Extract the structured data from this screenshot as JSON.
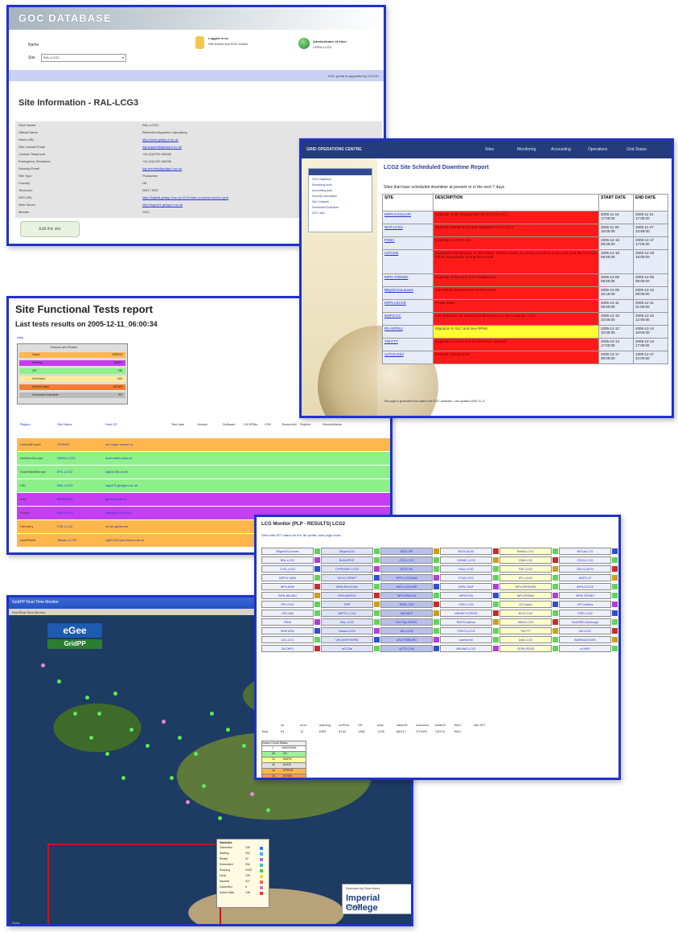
{
  "colors": {
    "border": "#1f33c9",
    "downtime_red": "#ff1a1a",
    "downtime_yellow": "#ffff33",
    "test_orange": "#ffb74d",
    "test_green": "#8ef08a",
    "test_purple": "#c33ff0"
  },
  "site_info": {
    "header_logo": "GOC DATABASE",
    "form_name_label": "Name",
    "form_name_value": "",
    "form_site_label": "Site",
    "form_site_value": "RAL-LCG2",
    "login_title": "Logged in as",
    "login_text": "Site Admin and ROC Admin",
    "role_title": "Administrator of sites:",
    "role_text": "CERN-LCG2",
    "band_text": "GOC portal is supported by CCLRC",
    "page_title": "Site Information - RAL-LCG3",
    "rows": [
      {
        "k": "Short Name",
        "v": "RAL-LCG3"
      },
      {
        "k": "Official Name",
        "v": "Rutherford Appleton Laboratory"
      },
      {
        "k": "Home URL",
        "v": "http://www.gridpp.rl.ac.uk"
      },
      {
        "k": "Site Contact Email",
        "v": "lcg-support@gridpp.rl.ac.uk"
      },
      {
        "k": "Contact Telephone",
        "v": "+44 (0)1235 445000"
      },
      {
        "k": "Emergency Telephone",
        "v": "+44 (0)1235 446000"
      },
      {
        "k": "Security Email",
        "v": "lcg-security@gridpp.rl.ac.uk"
      },
      {
        "k": "Site Type",
        "v": "Production"
      },
      {
        "k": "Country",
        "v": "UK"
      },
      {
        "k": "Timezone",
        "v": "GMT / BST"
      },
      {
        "k": "GIIS URL",
        "v": "ldap://lcgbdii.gridpp.rl.ac.uk:2170/mds-vo-name=local,o=grid"
      },
      {
        "k": "Web Server",
        "v": "http://lcgce01.gridpp.rl.ac.uk"
      },
      {
        "k": "Monitor",
        "v": "GOC"
      }
    ],
    "button": "Edit this site"
  },
  "downtime": {
    "nav": [
      "GRID OPERATIONS CENTRE",
      "Sites",
      "Monitoring",
      "Accounting",
      "Operations",
      "Grid Status"
    ],
    "menu": [
      "GOC Database",
      "Monitoring tools",
      "Accounting data",
      "Security Information",
      "Site Contacts",
      "Scheduled Downtime",
      "GOC Wiki"
    ],
    "title": "LCG2 Site Scheduled Downtime Report",
    "subtitle": "Sites that have scheduled downtime at present or in the next 7 days",
    "headers": [
      "SITE",
      "DESCRIPTION",
      "START DATE",
      "END DATE"
    ],
    "rows": [
      {
        "site": "INFN-CAGLIARI",
        "desc": "Upgrade of the storage and CE to LCG 2.6.0",
        "start": "2005-11-16 17:00:00",
        "end": "2005-11-21 17:00:00",
        "color": "red"
      },
      {
        "site": "NCP-LCG2",
        "desc": "Network maintenance and upgrade to LCG-2.6.0",
        "start": "2005-11-25 18:00:00",
        "end": "2005-11-27 23:59:00",
        "color": "red"
      },
      {
        "site": "PSNC",
        "desc": "Upgrade to LCG 2.6.0",
        "start": "2005-12-15 09:00:00",
        "end": "2005-12-17 17:00:00",
        "color": "red"
      },
      {
        "site": "csTCDie",
        "desc": "Hardware maintenance of the cluster. Worker nodes are being moved to a new rack and the services will be unavailable during this period.",
        "start": "2005-12-16 09:00:00",
        "end": "2005-12-18 18:00:00",
        "color": "red"
      },
      {
        "site": "INFN-TORINO",
        "desc": "Upgrade of the LCG 2.6.0 middleware",
        "start": "2005-12-05 09:00:00",
        "end": "2005-12-08 09:00:00",
        "color": "red"
      },
      {
        "site": "BEgrid-KULeuven",
        "desc": "Scheduled downtime for maintenance",
        "start": "2005-12-06 10:15:00",
        "end": "2005-12-10 09:00:00",
        "color": "red"
      },
      {
        "site": "INFN-LECCE",
        "desc": "Power down",
        "start": "2005-12-11 09:00:00",
        "end": "2005-12-11 21:00:00",
        "color": "red"
      },
      {
        "site": "IN2P3-CC",
        "desc": "Site shutdown for electrical maintenance in the computer room",
        "start": "2005-12-10 10:00:00",
        "end": "2005-12-10 12:00:00",
        "color": "red"
      },
      {
        "site": "RU-SPbSU",
        "desc": "Migration to SLC and new RPMs",
        "start": "2005-12-12 10:00:00",
        "end": "2005-12-14 18:00:00",
        "color": "yellow"
      },
      {
        "site": "TW-FTT",
        "desc": "Upgrade to LCG 2.6.0 and firmware upgrade",
        "start": "2005-12-13 17:00:00",
        "end": "2005-12-14 17:00:00",
        "color": "red"
      },
      {
        "site": "cyTCD-Grid",
        "desc": "Network maintenance",
        "start": "2005-12-17 09:00:00",
        "end": "2005-12-17 22:00:00",
        "color": "red"
      }
    ],
    "footer": "This page is generated from data in the GOC database. Last updated 2005-12-11"
  },
  "functional": {
    "title": "Site Functional Tests report",
    "subtitle": "Last tests results on 2005-12-11_06:00:34",
    "link": "Help",
    "legend_title": "Colours and Status",
    "legend": [
      {
        "label": "Failed",
        "code": "ERROR",
        "color": "#ffb74d"
      },
      {
        "label": "Warning",
        "code": "WARN",
        "color": "#c33ff0"
      },
      {
        "label": "OK",
        "code": "OK",
        "color": "#8ef08a"
      },
      {
        "label": "Not tested",
        "code": "N/A",
        "color": "#ffe99a"
      },
      {
        "label": "Service down",
        "code": "DOWN",
        "color": "#ff7a33"
      },
      {
        "label": "Scheduled downtime",
        "code": "SD",
        "color": "#bbbbbb"
      }
    ],
    "columns": [
      "Region",
      "Site Name",
      "Host CE",
      "Test date",
      "Version",
      "Software",
      "CA RPMs",
      "CSH",
      "BrokerInfo",
      "Replica",
      "ServiceName"
    ],
    "rows": [
      {
        "region": "CentralEurope",
        "site": "CESNET",
        "ce": "ce1.egee.cesnet.cz",
        "color": "#ffb74d"
      },
      {
        "region": "NorthernEurope",
        "site": "SARA-LCG2",
        "ce": "mu6.matrix.sara.nl",
        "color": "#8ef08a"
      },
      {
        "region": "SouthWestEurope",
        "site": "IFIC-LCG2",
        "ce": "lcg2ce.ific.uv.es",
        "color": "#8ef08a"
      },
      {
        "region": "UKI",
        "site": "RAL-LCG2",
        "ce": "lcgce01.gridpp.rl.ac.uk",
        "color": "#8ef08a"
      },
      {
        "region": "Italy",
        "site": "INFN-PISA",
        "ce": "gridce.pi.infn.it",
        "color": "#c33ff0"
      },
      {
        "region": "France",
        "site": "IN2P3-LPC",
        "ce": "clrlcgce01.in2p3.fr",
        "color": "#c33ff0"
      },
      {
        "region": "Germany",
        "site": "FZK-LCG2",
        "ce": "ce-fzk.gridka.de",
        "color": "#ffb74d"
      },
      {
        "region": "AsiaPacific",
        "site": "Taiwan-LCG2",
        "ce": "lcg00125.grid.sinica.edu.tw",
        "color": "#ffb74d"
      }
    ]
  },
  "map": {
    "title_bar": "GridPP Real Time Monitor",
    "tab": "Grid Real Time Monitor",
    "egee": "eGee",
    "gridpp": "GridPP",
    "stats_title": "Statistics",
    "stats": [
      {
        "label": "Submitted",
        "value": "105"
      },
      {
        "label": "Waiting",
        "value": "302"
      },
      {
        "label": "Ready",
        "value": "97"
      },
      {
        "label": "Scheduled",
        "value": "294"
      },
      {
        "label": "Running",
        "value": "2333"
      },
      {
        "label": "Done",
        "value": "125"
      },
      {
        "label": "Aborted",
        "value": "417"
      },
      {
        "label": "Cancelled",
        "value": "6"
      },
      {
        "label": "Active Sites",
        "value": "135"
      }
    ],
    "imperial_small": "Developed by Gidon Moont",
    "imperial_big": "Imperial College",
    "imperial_city": "London",
    "status": "Done"
  },
  "monitor": {
    "title": "LCG Monitor (PLP - RESULTS) LCG2",
    "subtitle": "Sites with SFT status for the 'all' profile: web page index",
    "summary_headers": [
      "",
      "ok",
      "error",
      "warning",
      "notTest",
      "OK",
      "total",
      "sitesOK",
      "unknown",
      "totalCE",
      "BDII",
      "site.SFT"
    ],
    "summary_values": [
      "Total",
      "94",
      "12",
      "ERR",
      "5134",
      "1360",
      "1705",
      "88/117",
      "OTHER",
      "CE/CS",
      "BDII"
    ],
    "counts_headers": [
      "Colour",
      "Count",
      "Status"
    ],
    "counts": [
      {
        "n": "1",
        "s": "UNKNOWN"
      },
      {
        "n": "90",
        "s": "OK"
      },
      {
        "n": "24",
        "s": "WARN"
      },
      {
        "n": "30",
        "s": "NODE"
      },
      {
        "n": "16",
        "s": "ERROR"
      },
      {
        "n": "16",
        "s": "DOWN"
      },
      {
        "n": "20",
        "s": "SD"
      },
      {
        "n": "24",
        "s": "UNKNOWN"
      },
      {
        "n": "4",
        "s": "ABSENT"
      }
    ],
    "cells": [
      "BEgrid-KULeuven",
      "BEgrid-ULB",
      "BG01-IPP",
      "BG04-ACAD",
      "BHAM-LCG2",
      "BITLab-LCG",
      "BNL-LCG2",
      "BUDAPEST",
      "CGG-LCG2",
      "CIEMAT-LCG2",
      "CNB-LCG2",
      "CSCS-LCG2",
      "CY01-LCG2",
      "CYFRONET-LCG2",
      "DESY-HH",
      "FNAL-LCG2",
      "FZK-LCG2",
      "GR-01-AUTH",
      "HEPHY-UIBK",
      "HG-01-GRNET",
      "HPTC-LCG2ia64",
      "IFCA-LCG2",
      "IFIC-LCG2",
      "IN2P3-CC",
      "INFN-BARI",
      "INFN-BOLOGNA",
      "INFN-CAGLIARI",
      "INFN-CNAF",
      "INFN-FERRARA",
      "INFN-LECCE",
      "INFN-MILANO",
      "INFN-NAPOLI",
      "INFN-PADOVA",
      "INFN-PISA",
      "INFN-ROMA1",
      "INFN-TORINO",
      "IPP-LCG2",
      "ITEP",
      "JINR-LCG2",
      "KFKI-LCG2",
      "LIP-Lisbon",
      "LIP-Coimbra",
      "LRZ-LMU",
      "M3PEC-LCG2",
      "MANHEP",
      "NIKHEF-ELPROD",
      "NCP-LCG2",
      "PNPI-LCG2",
      "PSNC",
      "RAL-LCG2",
      "RU-Phys-SPbSU",
      "RWTH-Aachen",
      "SARA-LCG2",
      "ScotGRID-Edinburgh",
      "SINP-MSU",
      "Taiwan-LCG2",
      "TAU-LCG2",
      "TOKYO-LCG2",
      "TW-FTT",
      "UB-LCG2",
      "UCL-CCC",
      "UKI-NORTHGRID",
      "UNI-FREIBURG",
      "uscms-fnal",
      "UoM-LCG2",
      "WARSAW-EGEE",
      "ZA-CHPC",
      "csTCDie",
      "cyTCD-Grid",
      "BEIJING-LCG2",
      "CERN-PROD",
      "ru-IHEP"
    ]
  }
}
